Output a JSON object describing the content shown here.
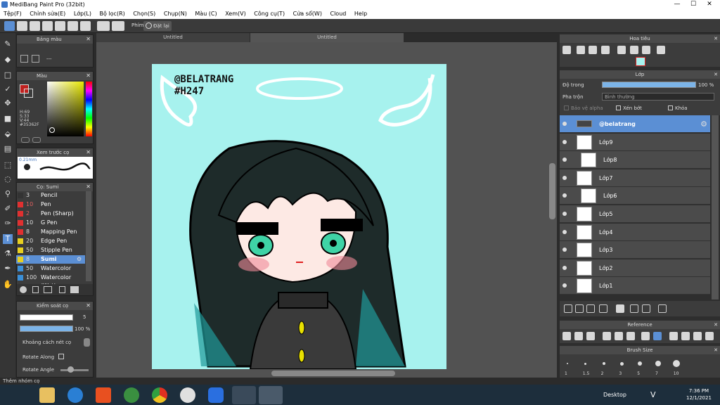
{
  "app": {
    "title": "MediBang Paint Pro (32bit)"
  },
  "menu": [
    "Tệp(F)",
    "Chỉnh sửa(E)",
    "Lớp(L)",
    "Bộ lọc(R)",
    "Chọn(S)",
    "Chụp(N)",
    "Màu (C)",
    "Xem(V)",
    "Công cụ(T)",
    "Cửa sổ(W)",
    "Cloud",
    "Help"
  ],
  "toolbar": {
    "shortcut_label": "Phím",
    "reset_label": "Đặt lại"
  },
  "tabs": [
    "Untitled",
    "Untitled"
  ],
  "palette": {
    "title": "Bảng màu",
    "more": "---"
  },
  "color": {
    "title": "Màu",
    "h": "H:69",
    "s": "S:33",
    "v": "V:44",
    "hex": "#35362F",
    "main_color": "#35362F"
  },
  "brush_preview": {
    "title": "Xem trước cọ",
    "size": "0.21mm"
  },
  "brush": {
    "title": "Cọ: Sumi",
    "items": [
      {
        "size": "3",
        "name": "Pencil",
        "color": "#333333",
        "size_color": "#dddddd"
      },
      {
        "size": "10",
        "name": "Pen",
        "color": "#e03030",
        "size_color": "#e06060"
      },
      {
        "size": "2",
        "name": "Pen (Sharp)",
        "color": "#e03030",
        "size_color": "#e06060"
      },
      {
        "size": "10",
        "name": "G Pen",
        "color": "#e03030",
        "size_color": "#dddddd"
      },
      {
        "size": "8",
        "name": "Mapping Pen",
        "color": "#e03030",
        "size_color": "#dddddd"
      },
      {
        "size": "20",
        "name": "Edge Pen",
        "color": "#e8d020",
        "size_color": "#dddddd"
      },
      {
        "size": "50",
        "name": "Stipple Pen",
        "color": "#e8d020",
        "size_color": "#dddddd"
      },
      {
        "size": "8",
        "name": "Sumi",
        "color": "#e8d020",
        "size_color": "#dddddd"
      },
      {
        "size": "50",
        "name": "Watercolor",
        "color": "#3a8fd8",
        "size_color": "#dddddd"
      },
      {
        "size": "100",
        "name": "Watercolor (Wet)",
        "color": "#3a8fd8",
        "size_color": "#dddddd"
      },
      {
        "size": "",
        "name": "Airbrush",
        "color": "#3a8fd8",
        "size_color": "#dddddd"
      }
    ],
    "selected_index": 7
  },
  "brush_control": {
    "title": "Kiểm soát cọ",
    "size": "5",
    "opacity": "100 %",
    "opacity_value": 100,
    "spacing_label": "Khoảng cách nét cọ",
    "rotate_along": "Rotate Along",
    "rotate_angle": "Rotate Angle"
  },
  "navigator": {
    "title": "Hoa tiêu"
  },
  "layers": {
    "title": "Lớp",
    "opacity_label": "Độ trong",
    "opacity": "100 %",
    "opacity_value": 100,
    "blend_label": "Pha trộn",
    "blend": "Bình thường",
    "protect_alpha": "Bảo vệ alpha",
    "clip": "Xén bớt",
    "lock": "Khóa",
    "items": [
      "@belatrang",
      "Lớp9",
      "Lớp8",
      "Lớp7",
      "Lớp6",
      "Lớp5",
      "Lớp4",
      "Lớp3",
      "Lớp2",
      "Lớp1"
    ],
    "selected_index": 0
  },
  "reference": {
    "title": "Reference"
  },
  "brush_size": {
    "title": "Brush Size",
    "values": [
      "1",
      "1.5",
      "2",
      "3",
      "5",
      "7",
      "10"
    ]
  },
  "statusbar": {
    "text": "Thêm nhóm cọ"
  },
  "taskbar": {
    "desktop_label": "Desktop",
    "time": "7:36 PM",
    "date": "12/1/2021",
    "lang": "V"
  },
  "artwork": {
    "watermark": [
      "@BELATRANG",
      "#H247"
    ],
    "bg_color": "#a7f2ee"
  }
}
